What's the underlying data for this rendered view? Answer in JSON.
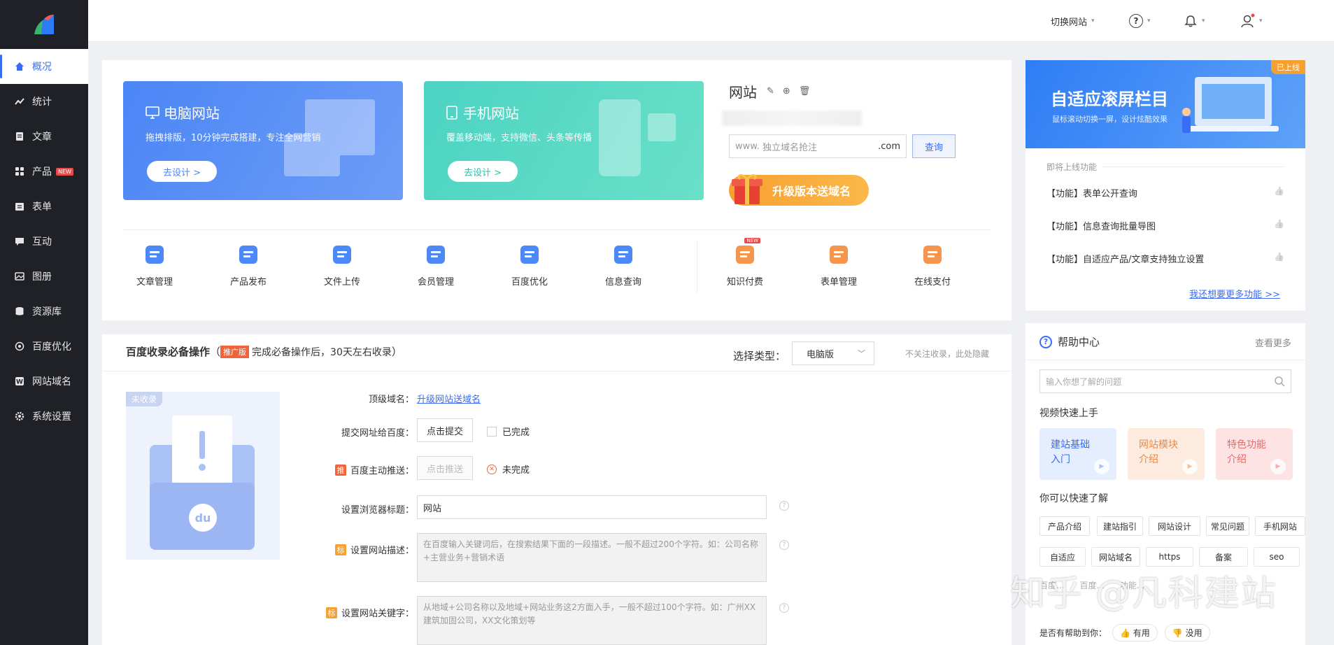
{
  "sidebar": {
    "items": [
      {
        "label": "概况",
        "icon": "home-icon"
      },
      {
        "label": "统计",
        "icon": "stats-icon"
      },
      {
        "label": "文章",
        "icon": "article-icon"
      },
      {
        "label": "产品",
        "icon": "product-icon",
        "badge": "NEW"
      },
      {
        "label": "表单",
        "icon": "form-icon"
      },
      {
        "label": "互动",
        "icon": "chat-icon"
      },
      {
        "label": "图册",
        "icon": "album-icon"
      },
      {
        "label": "资源库",
        "icon": "database-icon"
      },
      {
        "label": "百度优化",
        "icon": "seo-icon"
      },
      {
        "label": "网站域名",
        "icon": "domain-icon"
      },
      {
        "label": "系统设置",
        "icon": "gear-icon"
      }
    ]
  },
  "topbar": {
    "switch_site": "切换网站"
  },
  "cards": {
    "pc": {
      "title": "电脑网站",
      "subtitle": "拖拽排版，10分钟完成搭建，专注全网营销",
      "button": "去设计 >"
    },
    "mobile": {
      "title": "手机网站",
      "subtitle": "覆盖移动端，支持微信、头条等传播",
      "button": "去设计 >"
    }
  },
  "site": {
    "title": "网站",
    "domain_prefix": "www.",
    "domain_placeholder": "独立域名抢注",
    "domain_suffix": ".com",
    "query_button": "查询",
    "upgrade_banner": "升级版本送域名"
  },
  "tools": [
    {
      "label": "文章管理",
      "color": "#3a7bf6"
    },
    {
      "label": "产品发布",
      "color": "#3a7bf6"
    },
    {
      "label": "文件上传",
      "color": "#3a7bf6"
    },
    {
      "label": "会员管理",
      "color": "#3a7bf6"
    },
    {
      "label": "百度优化",
      "color": "#3a7bf6"
    },
    {
      "label": "信息查询",
      "color": "#3a7bf6"
    },
    {
      "label": "知识付费",
      "color": "#f58a3a",
      "badge": "NEW"
    },
    {
      "label": "表单管理",
      "color": "#f58a3a"
    },
    {
      "label": "在线支付",
      "color": "#f58a3a"
    }
  ],
  "baidu": {
    "title": "百度收录必备操作",
    "paren_open": "（",
    "tag": "推广版",
    "desc": "完成必备操作后，30天左右收录",
    "paren_close": "）",
    "type_label": "选择类型：",
    "type_value": "电脑版",
    "hide_hint": "不关注收录，此处隐藏",
    "status_badge": "未收录",
    "fields": {
      "top_domain_label": "顶级域名：",
      "top_domain_link": "升级网站送域名",
      "submit_label": "提交网址给百度：",
      "submit_button": "点击提交",
      "submit_status": "已完成",
      "push_tag": "推",
      "push_label": "百度主动推送：",
      "push_button": "点击推送",
      "push_status": "未完成",
      "browser_title_label": "设置浏览器标题：",
      "browser_title_value": "网站",
      "desc_tag": "标",
      "desc_label": "设置网站描述：",
      "desc_placeholder": "在百度输入关键词后，在搜索结果下面的一段描述。一般不超过200个字符。如：公司名称+主营业务+营销术语",
      "kw_tag": "标",
      "kw_label": "设置网站关键字：",
      "kw_placeholder": "从地域+公司名称以及地域+网站业务这2方面入手，一般不超过100个字符。如：广州XX建筑加固公司，XX文化策划等"
    }
  },
  "promo": {
    "title": "自适应滚屏栏目",
    "subtitle": "鼠标滚动切换一屏，设计炫酷效果",
    "badge": "已上线"
  },
  "upcoming": {
    "heading": "即将上线功能",
    "items": [
      "【功能】表单公开查询",
      "【功能】信息查询批量导图",
      "【功能】自适应产品/文章支持独立设置"
    ],
    "more_link": "我还想要更多功能 >>"
  },
  "help": {
    "title": "帮助中心",
    "more": "查看更多",
    "search_placeholder": "输入你想了解的问题",
    "video_heading": "视频快速上手",
    "videos": [
      {
        "line1": "建站基础",
        "line2": "入门"
      },
      {
        "line1": "网站模块",
        "line2": "介绍"
      },
      {
        "line1": "特色功能",
        "line2": "介绍"
      }
    ],
    "quick_heading": "你可以快速了解",
    "tags": [
      "产品介绍",
      "建站指引",
      "网站设计",
      "常见问题",
      "手机网站",
      "自适应",
      "网站域名",
      "https",
      "备案",
      "seo"
    ],
    "partial_tags": [
      "百度...",
      "百度...",
      "功能..."
    ],
    "feedback_label": "是否有帮助到你：",
    "useful": "有用",
    "useless": "没用"
  },
  "watermark": "知乎 @凡科建站"
}
